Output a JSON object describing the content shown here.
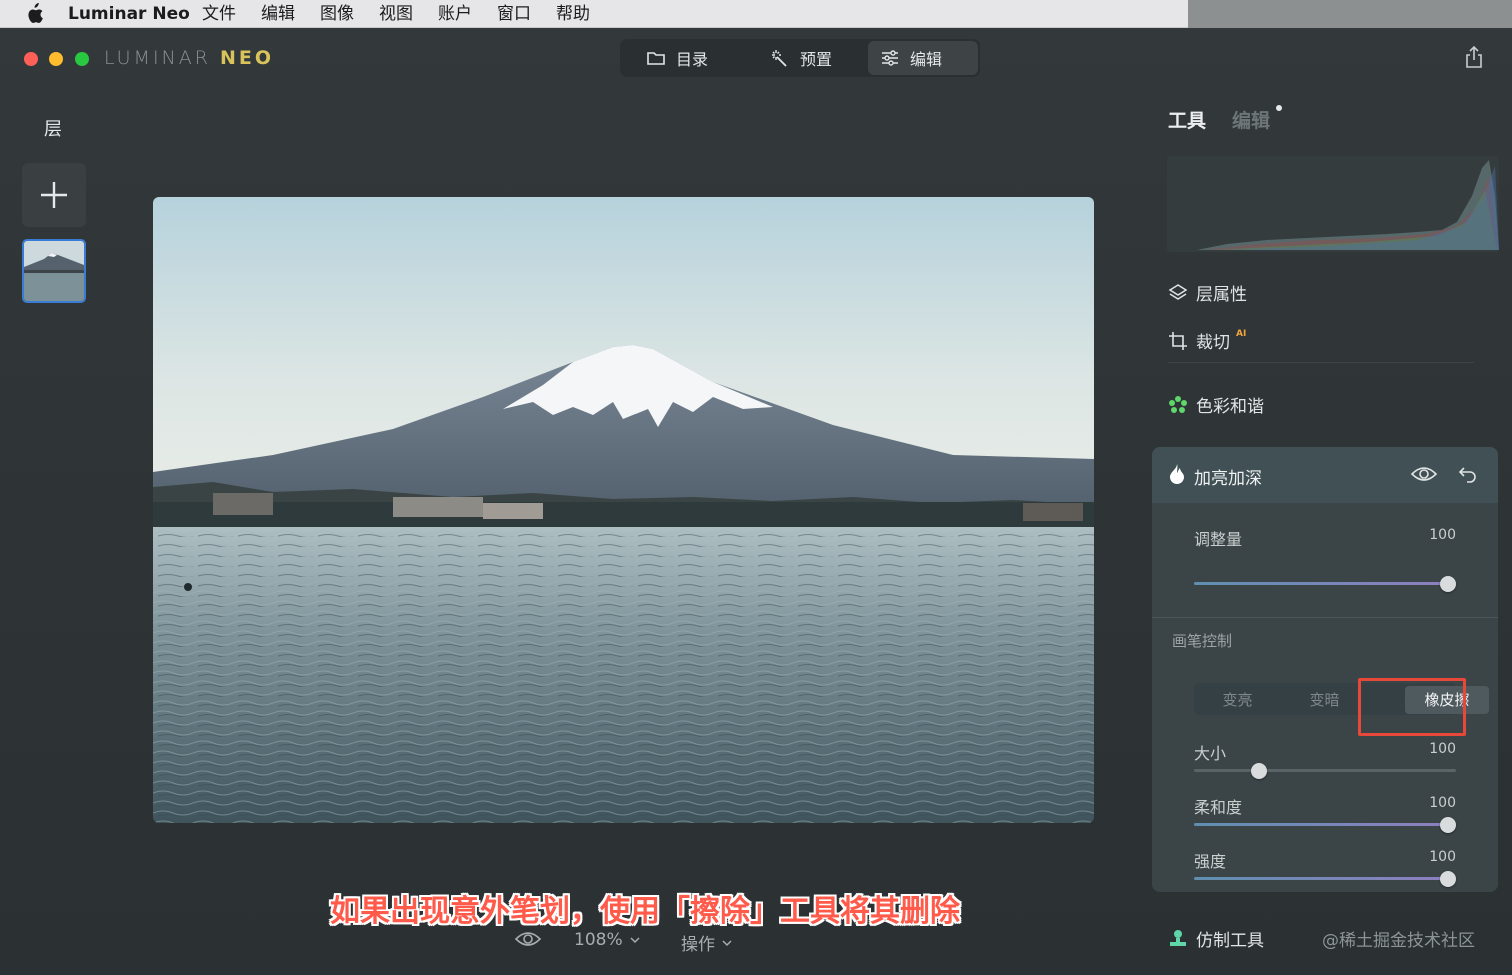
{
  "menubar": {
    "app_name": "Luminar Neo",
    "items": [
      "文件",
      "编辑",
      "图像",
      "视图",
      "账户",
      "窗口",
      "帮助"
    ]
  },
  "window": {
    "logo_main": "LUMINAR",
    "logo_neo": "NEO",
    "modes": [
      {
        "label": "目录",
        "icon": "folder-icon"
      },
      {
        "label": "预置",
        "icon": "magic-wand-icon"
      },
      {
        "label": "编辑",
        "icon": "sliders-icon",
        "active": true
      }
    ]
  },
  "layers": {
    "title": "层"
  },
  "canvas": {
    "zoom": "108%",
    "actions_label": "操作"
  },
  "caption": "如果出现意外笔划，使用「擦除」工具将其删除",
  "panel": {
    "tab_tools": "工具",
    "tab_edits": "编辑",
    "tools": {
      "layer_properties": "层属性",
      "crop": "裁切",
      "crop_badge": "AI",
      "color_harmony": "色彩和谐",
      "clone_tool": "仿制工具"
    },
    "dodge_burn": {
      "title": "加亮加深",
      "amount_label": "调整量",
      "amount_value": "100",
      "brush_section": "画笔控制",
      "brush_modes": [
        "变亮",
        "变暗",
        "橡皮擦"
      ],
      "active_mode": "橡皮擦",
      "size_label": "大小",
      "size_value": "100",
      "softness_label": "柔和度",
      "softness_value": "100",
      "strength_label": "强度",
      "strength_value": "100"
    }
  },
  "watermark": "@稀土掘金技术社区",
  "colors": {
    "accent_blue": "#3a7bd5",
    "highlight_red": "#e8483a",
    "caption_red": "#ff5a4a"
  }
}
